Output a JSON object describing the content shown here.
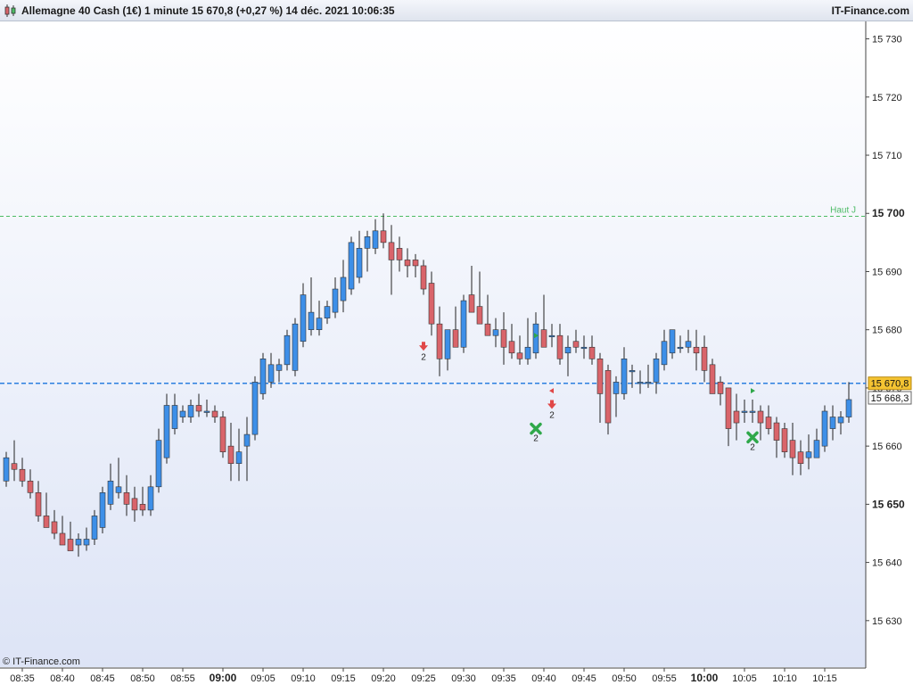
{
  "header": {
    "title": "Allemagne 40 Cash (1€) 1 minute 15 670,8 (+0,27 %) 14 déc. 2021 10:06:35",
    "brand": "IT-Finance.com"
  },
  "footer": {
    "credit": "© IT-Finance.com"
  },
  "colors": {
    "bull": "#3d8fe8",
    "bear": "#d9646a",
    "wick": "#222222",
    "haut_line": "#4cbb64",
    "price_line": "#2b7fe0",
    "price_label_bg": "#f5c432",
    "prev_label_bg": "#ffffff",
    "bg_top": "#ffffff",
    "bg_bottom": "#dde4f6"
  },
  "chart_data": {
    "type": "candlestick",
    "x_ticks": [
      "08:35",
      "08:40",
      "08:45",
      "08:50",
      "08:55",
      "09:00",
      "09:05",
      "09:10",
      "09:15",
      "09:20",
      "09:25",
      "09:30",
      "09:35",
      "09:40",
      "09:45",
      "09:50",
      "09:55",
      "10:00",
      "10:05",
      "10:10",
      "10:15"
    ],
    "bold_x_ticks": [
      "09:00",
      "10:00"
    ],
    "y_ticks": [
      "15 630",
      "15 640",
      "15 650",
      "15 660",
      "15 670",
      "15 680",
      "15 690",
      "15 700",
      "15 710",
      "15 720",
      "15 730"
    ],
    "bold_y_ticks": [
      "15 650",
      "15 700"
    ],
    "ylim": [
      15622,
      15733
    ],
    "start_time": "08:33",
    "candles": [
      {
        "o": 15654,
        "h": 15659,
        "l": 15653,
        "c": 15658
      },
      {
        "o": 15657,
        "h": 15661,
        "l": 15654,
        "c": 15656
      },
      {
        "o": 15656,
        "h": 15658,
        "l": 15653,
        "c": 15654
      },
      {
        "o": 15654,
        "h": 15656,
        "l": 15651,
        "c": 15652
      },
      {
        "o": 15652,
        "h": 15654,
        "l": 15647,
        "c": 15648
      },
      {
        "o": 15648,
        "h": 15652,
        "l": 15646,
        "c": 15646
      },
      {
        "o": 15647,
        "h": 15649,
        "l": 15644,
        "c": 15645
      },
      {
        "o": 15645,
        "h": 15648,
        "l": 15643,
        "c": 15643
      },
      {
        "o": 15644,
        "h": 15647,
        "l": 15642,
        "c": 15642
      },
      {
        "o": 15643,
        "h": 15645,
        "l": 15641,
        "c": 15644
      },
      {
        "o": 15643,
        "h": 15646,
        "l": 15642,
        "c": 15644
      },
      {
        "o": 15644,
        "h": 15649,
        "l": 15643,
        "c": 15648
      },
      {
        "o": 15646,
        "h": 15653,
        "l": 15645,
        "c": 15652
      },
      {
        "o": 15650,
        "h": 15657,
        "l": 15649,
        "c": 15654
      },
      {
        "o": 15652,
        "h": 15658,
        "l": 15651,
        "c": 15653
      },
      {
        "o": 15652,
        "h": 15655,
        "l": 15648,
        "c": 15650
      },
      {
        "o": 15651,
        "h": 15653,
        "l": 15647,
        "c": 15649
      },
      {
        "o": 15650,
        "h": 15653,
        "l": 15648,
        "c": 15649
      },
      {
        "o": 15649,
        "h": 15655,
        "l": 15648,
        "c": 15653
      },
      {
        "o": 15653,
        "h": 15663,
        "l": 15652,
        "c": 15661
      },
      {
        "o": 15658,
        "h": 15669,
        "l": 15657,
        "c": 15667
      },
      {
        "o": 15663,
        "h": 15669,
        "l": 15662,
        "c": 15667
      },
      {
        "o": 15665,
        "h": 15667,
        "l": 15664,
        "c": 15666
      },
      {
        "o": 15665,
        "h": 15668,
        "l": 15664,
        "c": 15667
      },
      {
        "o": 15667,
        "h": 15669,
        "l": 15665,
        "c": 15666
      },
      {
        "o": 15666,
        "h": 15668,
        "l": 15665,
        "c": 15666
      },
      {
        "o": 15666,
        "h": 15667,
        "l": 15664,
        "c": 15665
      },
      {
        "o": 15665,
        "h": 15666,
        "l": 15658,
        "c": 15659
      },
      {
        "o": 15660,
        "h": 15664,
        "l": 15654,
        "c": 15657
      },
      {
        "o": 15657,
        "h": 15663,
        "l": 15654,
        "c": 15659
      },
      {
        "o": 15660,
        "h": 15665,
        "l": 15654,
        "c": 15662
      },
      {
        "o": 15662,
        "h": 15672,
        "l": 15661,
        "c": 15671
      },
      {
        "o": 15669,
        "h": 15676,
        "l": 15668,
        "c": 15675
      },
      {
        "o": 15671,
        "h": 15676,
        "l": 15670,
        "c": 15674
      },
      {
        "o": 15673,
        "h": 15675,
        "l": 15671,
        "c": 15674
      },
      {
        "o": 15674,
        "h": 15680,
        "l": 15673,
        "c": 15679
      },
      {
        "o": 15673,
        "h": 15682,
        "l": 15672,
        "c": 15681
      },
      {
        "o": 15678,
        "h": 15688,
        "l": 15677,
        "c": 15686
      },
      {
        "o": 15680,
        "h": 15689,
        "l": 15679,
        "c": 15683
      },
      {
        "o": 15680,
        "h": 15685,
        "l": 15679,
        "c": 15682
      },
      {
        "o": 15682,
        "h": 15685,
        "l": 15681,
        "c": 15684
      },
      {
        "o": 15683,
        "h": 15689,
        "l": 15682,
        "c": 15687
      },
      {
        "o": 15685,
        "h": 15692,
        "l": 15683,
        "c": 15689
      },
      {
        "o": 15687,
        "h": 15696,
        "l": 15686,
        "c": 15695
      },
      {
        "o": 15689,
        "h": 15697,
        "l": 15688,
        "c": 15694
      },
      {
        "o": 15694,
        "h": 15697,
        "l": 15690,
        "c": 15696
      },
      {
        "o": 15694,
        "h": 15699,
        "l": 15693,
        "c": 15697
      },
      {
        "o": 15697,
        "h": 15700,
        "l": 15694,
        "c": 15695
      },
      {
        "o": 15695,
        "h": 15698,
        "l": 15686,
        "c": 15692
      },
      {
        "o": 15694,
        "h": 15696,
        "l": 15690,
        "c": 15692
      },
      {
        "o": 15692,
        "h": 15694,
        "l": 15689,
        "c": 15691
      },
      {
        "o": 15692,
        "h": 15693,
        "l": 15689,
        "c": 15691
      },
      {
        "o": 15691,
        "h": 15692,
        "l": 15686,
        "c": 15687
      },
      {
        "o": 15688,
        "h": 15690,
        "l": 15679,
        "c": 15681
      },
      {
        "o": 15681,
        "h": 15684,
        "l": 15672,
        "c": 15675
      },
      {
        "o": 15675,
        "h": 15679,
        "l": 15673,
        "c": 15680
      },
      {
        "o": 15680,
        "h": 15684,
        "l": 15678,
        "c": 15677
      },
      {
        "o": 15677,
        "h": 15686,
        "l": 15676,
        "c": 15685
      },
      {
        "o": 15686,
        "h": 15691,
        "l": 15683,
        "c": 15683
      },
      {
        "o": 15684,
        "h": 15690,
        "l": 15681,
        "c": 15681
      },
      {
        "o": 15681,
        "h": 15686,
        "l": 15679,
        "c": 15679
      },
      {
        "o": 15679,
        "h": 15682,
        "l": 15677,
        "c": 15680
      },
      {
        "o": 15680,
        "h": 15683,
        "l": 15674,
        "c": 15677
      },
      {
        "o": 15678,
        "h": 15681,
        "l": 15675,
        "c": 15676
      },
      {
        "o": 15676,
        "h": 15679,
        "l": 15674,
        "c": 15675
      },
      {
        "o": 15675,
        "h": 15682,
        "l": 15674,
        "c": 15677
      },
      {
        "o": 15676,
        "h": 15683,
        "l": 15675,
        "c": 15681
      },
      {
        "o": 15680,
        "h": 15686,
        "l": 15679,
        "c": 15677
      },
      {
        "o": 15679,
        "h": 15681,
        "l": 15677,
        "c": 15679
      },
      {
        "o": 15679,
        "h": 15681,
        "l": 15674,
        "c": 15675
      },
      {
        "o": 15676,
        "h": 15679,
        "l": 15672,
        "c": 15677
      },
      {
        "o": 15678,
        "h": 15680,
        "l": 15676,
        "c": 15677
      },
      {
        "o": 15677,
        "h": 15679,
        "l": 15675,
        "c": 15677
      },
      {
        "o": 15677,
        "h": 15679,
        "l": 15674,
        "c": 15675
      },
      {
        "o": 15675,
        "h": 15676,
        "l": 15664,
        "c": 15669
      },
      {
        "o": 15673,
        "h": 15674,
        "l": 15662,
        "c": 15664
      },
      {
        "o": 15669,
        "h": 15672,
        "l": 15665,
        "c": 15671
      },
      {
        "o": 15669,
        "h": 15677,
        "l": 15668,
        "c": 15675
      },
      {
        "o": 15673,
        "h": 15674,
        "l": 15670,
        "c": 15673
      },
      {
        "o": 15671,
        "h": 15673,
        "l": 15669,
        "c": 15671
      },
      {
        "o": 15671,
        "h": 15674,
        "l": 15670,
        "c": 15671
      },
      {
        "o": 15671,
        "h": 15676,
        "l": 15669,
        "c": 15675
      },
      {
        "o": 15674,
        "h": 15680,
        "l": 15673,
        "c": 15678
      },
      {
        "o": 15676,
        "h": 15680,
        "l": 15675,
        "c": 15680
      },
      {
        "o": 15677,
        "h": 15679,
        "l": 15676,
        "c": 15677
      },
      {
        "o": 15677,
        "h": 15680,
        "l": 15676,
        "c": 15678
      },
      {
        "o": 15677,
        "h": 15680,
        "l": 15673,
        "c": 15676
      },
      {
        "o": 15677,
        "h": 15679,
        "l": 15671,
        "c": 15673
      },
      {
        "o": 15674,
        "h": 15675,
        "l": 15669,
        "c": 15669
      },
      {
        "o": 15671,
        "h": 15672,
        "l": 15667,
        "c": 15669
      },
      {
        "o": 15670,
        "h": 15670,
        "l": 15660,
        "c": 15663
      },
      {
        "o": 15666,
        "h": 15669,
        "l": 15661,
        "c": 15664
      },
      {
        "o": 15666,
        "h": 15668,
        "l": 15664,
        "c": 15666
      },
      {
        "o": 15666,
        "h": 15668,
        "l": 15664,
        "c": 15666
      },
      {
        "o": 15666,
        "h": 15667,
        "l": 15661,
        "c": 15664
      },
      {
        "o": 15665,
        "h": 15667,
        "l": 15662,
        "c": 15663
      },
      {
        "o": 15664,
        "h": 15665,
        "l": 15658,
        "c": 15661
      },
      {
        "o": 15663,
        "h": 15664,
        "l": 15658,
        "c": 15659
      },
      {
        "o": 15661,
        "h": 15664,
        "l": 15655,
        "c": 15658
      },
      {
        "o": 15659,
        "h": 15661,
        "l": 15655,
        "c": 15657
      },
      {
        "o": 15658,
        "h": 15662,
        "l": 15656,
        "c": 15659
      },
      {
        "o": 15658,
        "h": 15663,
        "l": 15658,
        "c": 15661
      },
      {
        "o": 15660,
        "h": 15667,
        "l": 15659,
        "c": 15666
      },
      {
        "o": 15663,
        "h": 15667,
        "l": 15661,
        "c": 15665
      },
      {
        "o": 15664,
        "h": 15666,
        "l": 15662,
        "c": 15665
      },
      {
        "o": 15665,
        "h": 15671,
        "l": 15664,
        "c": 15668
      }
    ],
    "reference_lines": [
      {
        "label": "Haut J",
        "value": 15699.5
      },
      {
        "label": "15 670,8",
        "value": 15670.8
      }
    ],
    "price_labels": [
      {
        "label": "15 670,8",
        "value": 15670.8,
        "style": "current"
      },
      {
        "label": "15 668,3",
        "value": 15668.3,
        "style": "previous"
      }
    ],
    "signals": [
      {
        "type": "arrow-down",
        "time": "09:25",
        "price": 15677,
        "label": "2"
      },
      {
        "type": "triangle-right",
        "time": "09:39",
        "price": 15679,
        "label": ""
      },
      {
        "type": "cross",
        "time": "09:39",
        "price": 15663,
        "label": "2"
      },
      {
        "type": "triangle-left",
        "time": "09:41",
        "price": 15669.5,
        "label": ""
      },
      {
        "type": "arrow-down",
        "time": "09:41",
        "price": 15667,
        "label": "2"
      },
      {
        "type": "triangle-right",
        "time": "10:06",
        "price": 15669.5,
        "label": ""
      },
      {
        "type": "cross",
        "time": "10:06",
        "price": 15661.5,
        "label": "2"
      }
    ]
  }
}
